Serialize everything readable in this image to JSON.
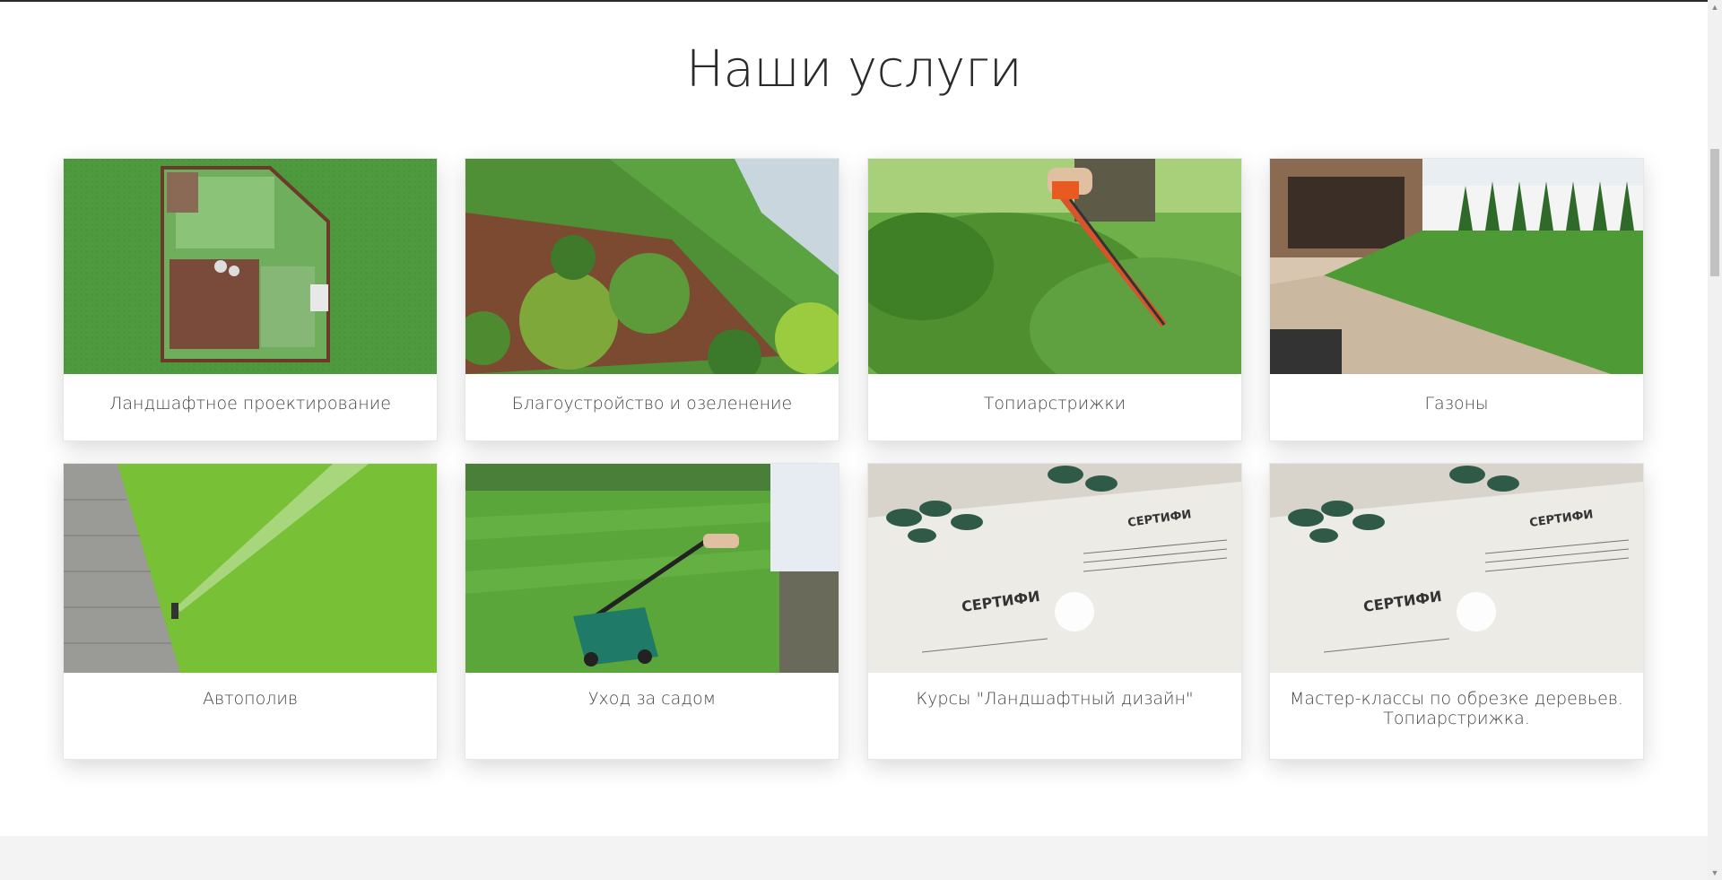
{
  "section": {
    "title": "Наши услуги"
  },
  "services": [
    {
      "label": "Ландшафтное проектирование",
      "image": "landscape-plan-image"
    },
    {
      "label": "Благоустройство и озеленение",
      "image": "garden-beds-image"
    },
    {
      "label": "Топиарстрижки",
      "image": "hedge-trimming-image"
    },
    {
      "label": "Газоны",
      "image": "lawn-yard-image"
    },
    {
      "label": "Автополив",
      "image": "sprinkler-image"
    },
    {
      "label": "Уход за садом",
      "image": "lawn-mower-image"
    },
    {
      "label": "Курсы \"Ландшафтный дизайн\"",
      "image": "certificate-image"
    },
    {
      "label": "Мастер-классы по обрезке деревьев. Топиарстрижка.",
      "image": "certificate-image"
    }
  ],
  "certificate": {
    "heading": "СЕРТИФИ"
  },
  "colors": {
    "grass": "#4a9a3a",
    "title": "#2a2a2a",
    "footer": "#f3f3f3"
  }
}
